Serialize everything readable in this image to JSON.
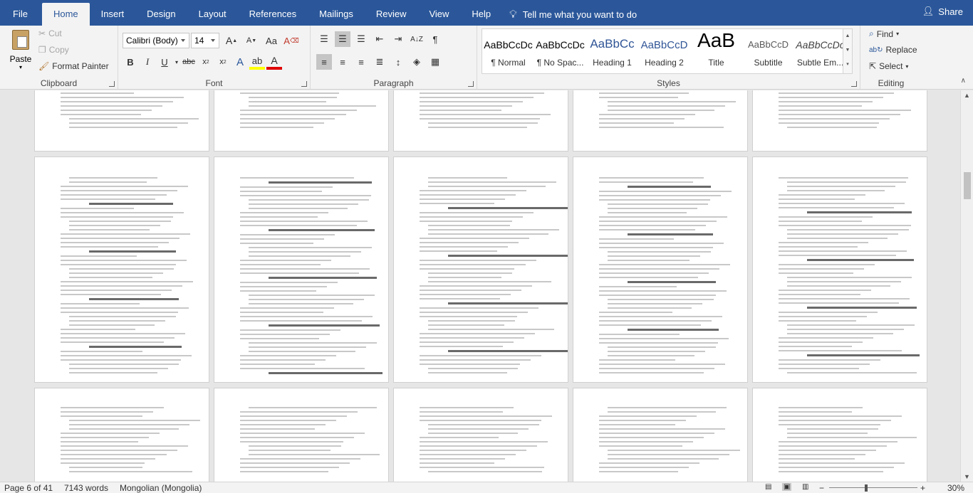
{
  "menu": {
    "tabs": [
      "File",
      "Home",
      "Insert",
      "Design",
      "Layout",
      "References",
      "Mailings",
      "Review",
      "View",
      "Help"
    ],
    "tellme": "Tell me what you want to do",
    "share": "Share"
  },
  "clipboard": {
    "paste": "Paste",
    "cut": "Cut",
    "copy": "Copy",
    "format_painter": "Format Painter",
    "label": "Clipboard"
  },
  "font": {
    "name": "Calibri (Body)",
    "size": "14",
    "label": "Font"
  },
  "paragraph": {
    "label": "Paragraph"
  },
  "styles": {
    "label": "Styles",
    "items": [
      {
        "preview": "AaBbCcDc",
        "name": "¶ Normal"
      },
      {
        "preview": "AaBbCcDc",
        "name": "¶ No Spac..."
      },
      {
        "preview": "AaBbCc",
        "name": "Heading 1"
      },
      {
        "preview": "AaBbCcD",
        "name": "Heading 2"
      },
      {
        "preview": "AaB",
        "name": "Title"
      },
      {
        "preview": "AaBbCcD",
        "name": "Subtitle"
      },
      {
        "preview": "AaBbCcDc",
        "name": "Subtle Em..."
      }
    ]
  },
  "editing": {
    "find": "Find",
    "replace": "Replace",
    "select": "Select",
    "label": "Editing"
  },
  "statusbar": {
    "page": "Page 6 of 41",
    "words": "7143 words",
    "language": "Mongolian (Mongolia)",
    "zoom": "30%"
  }
}
